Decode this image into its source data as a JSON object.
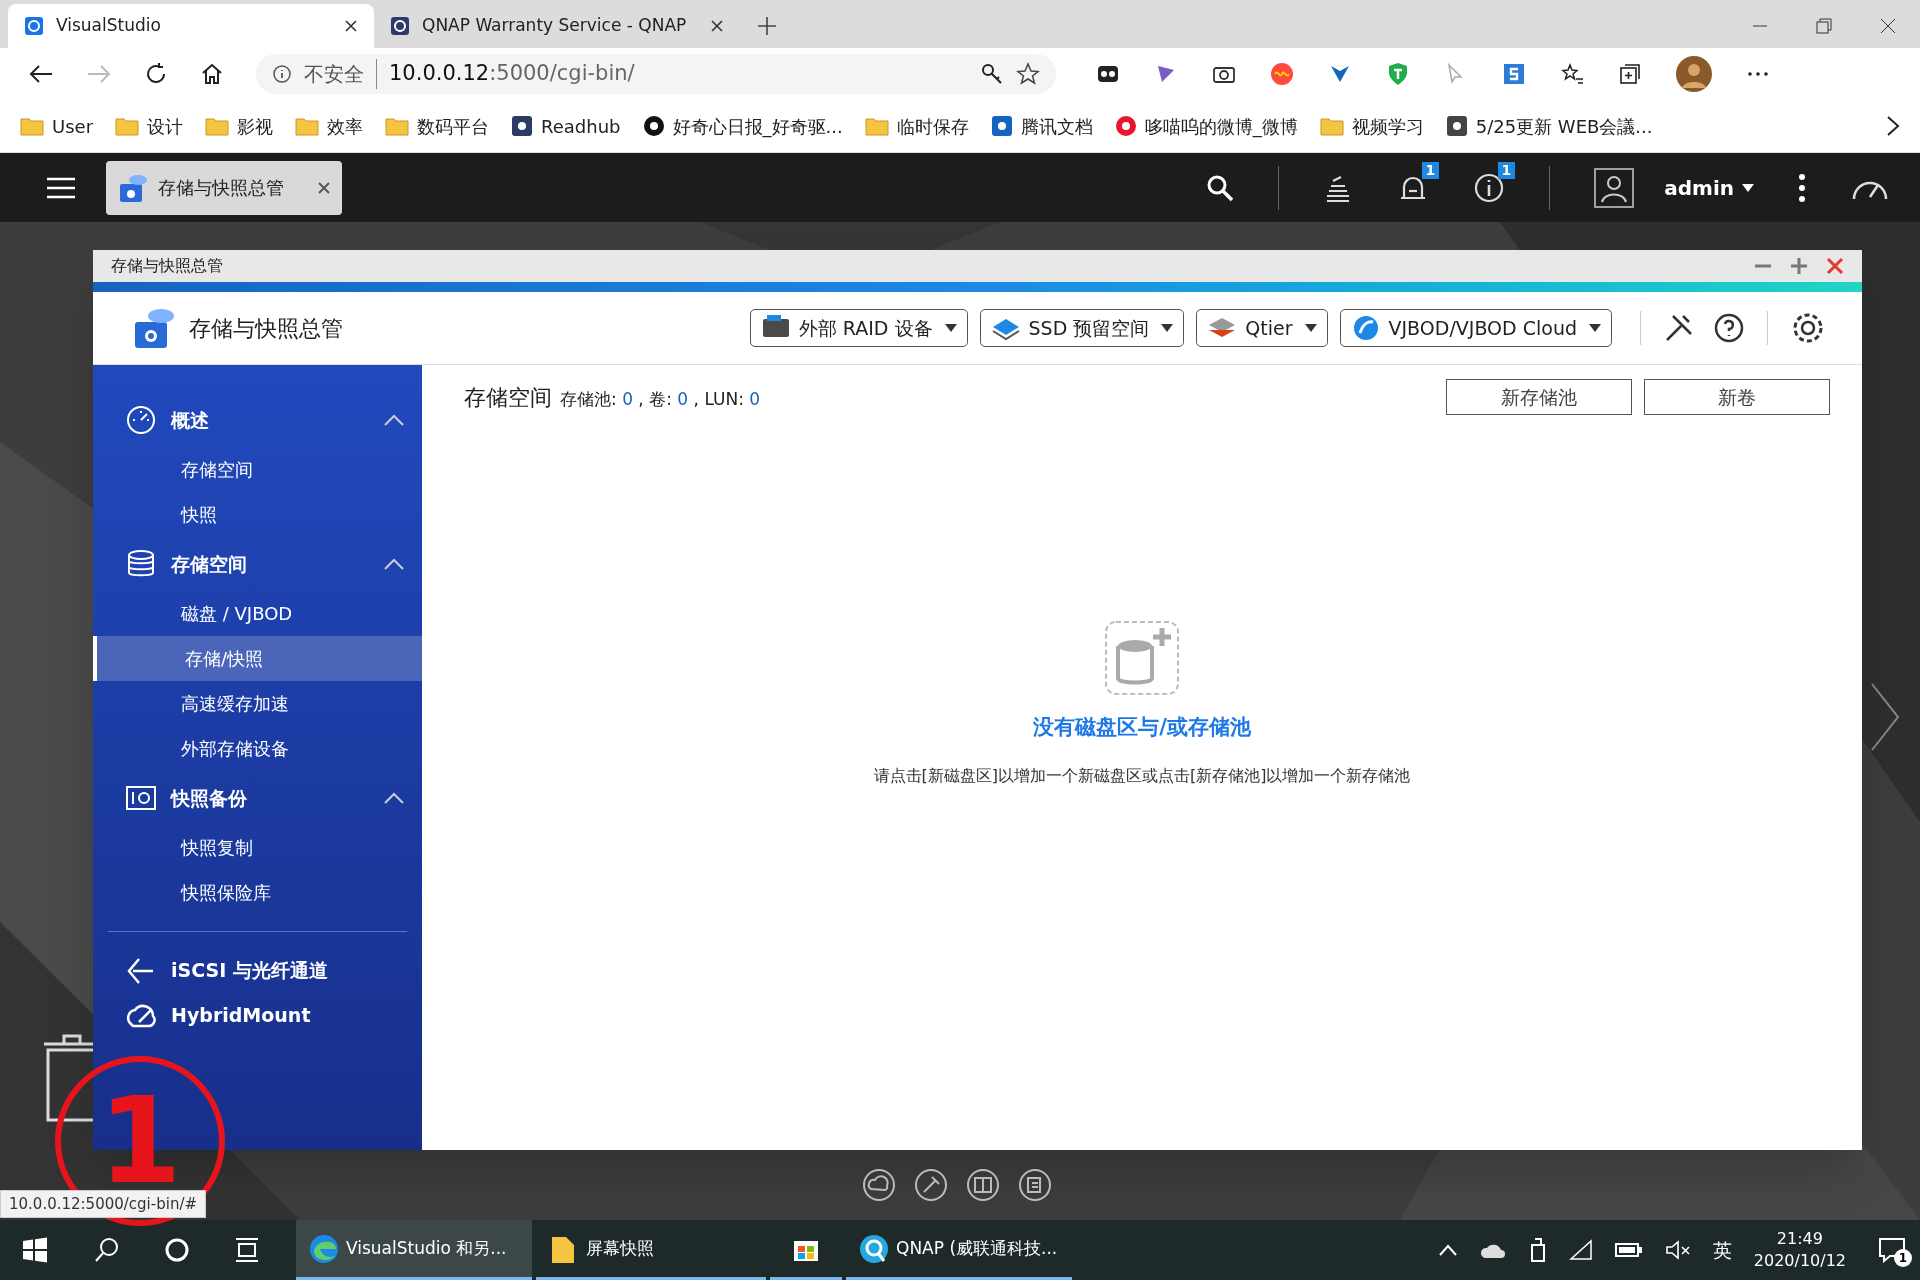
{
  "browser": {
    "tabs": [
      {
        "title": "VisualStudio",
        "selected": true
      },
      {
        "title": "QNAP Warranty Service - QNAP",
        "selected": false
      }
    ],
    "address": {
      "security": "不安全",
      "host": "10.0.0.12",
      "rest": ":5000/cgi-bin/"
    },
    "bookmarks": [
      {
        "label": "User",
        "kind": "folder"
      },
      {
        "label": "设计",
        "kind": "folder"
      },
      {
        "label": "影视",
        "kind": "folder"
      },
      {
        "label": "效率",
        "kind": "folder"
      },
      {
        "label": "数码平台",
        "kind": "folder"
      },
      {
        "label": "Readhub",
        "kind": "site"
      },
      {
        "label": "好奇心日报_好奇驱...",
        "kind": "site"
      },
      {
        "label": "临时保存",
        "kind": "folder"
      },
      {
        "label": "腾讯文档",
        "kind": "site"
      },
      {
        "label": "哆喵呜的微博_微博",
        "kind": "site"
      },
      {
        "label": "视频学习",
        "kind": "folder"
      },
      {
        "label": "5/25更新 WEB会議...",
        "kind": "site"
      }
    ]
  },
  "qnap_bar": {
    "app_tab": "存储与快照总管",
    "badges": [
      "1",
      "1"
    ],
    "user": "admin"
  },
  "window": {
    "title": "存储与快照总管",
    "app_name": "存储与快照总管",
    "menus": [
      "外部 RAID 设备",
      "SSD 预留空间",
      "Qtier",
      "VJBOD/VJBOD Cloud"
    ],
    "sidebar": [
      {
        "label": "概述",
        "kind": "section",
        "expanded": true,
        "children": [
          {
            "label": "存储空间",
            "selected": false
          },
          {
            "label": "快照",
            "selected": false
          }
        ]
      },
      {
        "label": "存储空间",
        "kind": "section",
        "expanded": true,
        "children": [
          {
            "label": "磁盘 / VJBOD",
            "selected": false
          },
          {
            "label": "存储/快照",
            "selected": true
          },
          {
            "label": "高速缓存加速",
            "selected": false
          },
          {
            "label": "外部存储设备",
            "selected": false
          }
        ]
      },
      {
        "label": "快照备份",
        "kind": "section",
        "expanded": true,
        "children": [
          {
            "label": "快照复制",
            "selected": false
          },
          {
            "label": "快照保险库",
            "selected": false
          }
        ]
      },
      {
        "label": "iSCSI 与光纤通道",
        "kind": "link"
      },
      {
        "label": "HybridMount",
        "kind": "link"
      }
    ],
    "heading": "存储空间",
    "separator": ",",
    "summary": [
      {
        "label": "存储池:",
        "value": "0"
      },
      {
        "label": "卷:",
        "value": "0"
      },
      {
        "label": "LUN:",
        "value": "0"
      }
    ],
    "buttons": [
      "新存储池",
      "新卷"
    ],
    "empty_title": "没有磁盘区与/或存储池",
    "empty_hint": "请点击[新磁盘区]以增加一个新磁盘区或点击[新存储池]以增加一个新存储池"
  },
  "status_url": "10.0.0.12:5000/cgi-bin/#",
  "annotation": "1",
  "taskbar": {
    "apps": [
      {
        "label": "VisualStudio 和另...",
        "selected": true
      },
      {
        "label": "屏幕快照",
        "selected": false
      },
      {
        "selected": false
      },
      {
        "label": "QNAP (威联通科技...",
        "selected": false
      }
    ],
    "ime": "英",
    "time": "21:49",
    "date": "2020/10/12",
    "notifications": "1"
  }
}
